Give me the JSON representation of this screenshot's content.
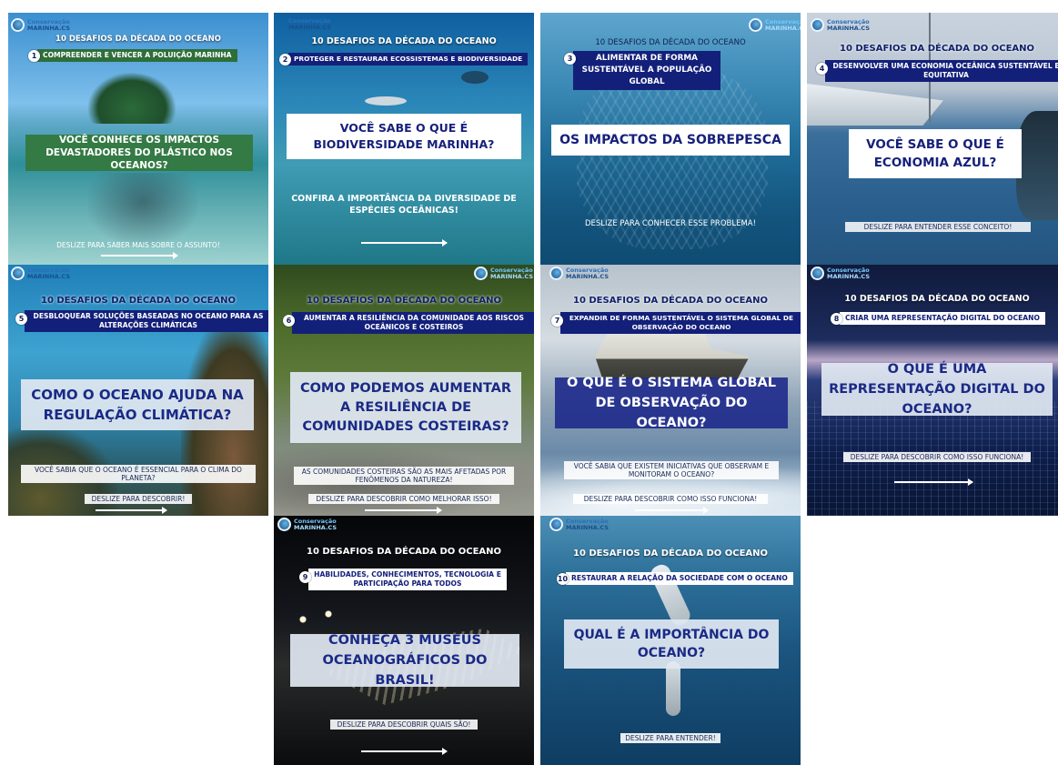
{
  "brand": {
    "line1": "Conservação",
    "line2": "MARINHA.CS"
  },
  "series_title": "10 DESAFIOS DA DÉCADA DO OCEANO",
  "cards": [
    {
      "num": "1",
      "challenge": "COMPREENDER E VENCER A POLUIÇÃO MARINHA",
      "question": "VOCÊ CONHECE OS IMPACTOS DEVASTADORES DO PLÁSTICO NOS OCEANOS?",
      "cta": "DESLIZE PARA SABER MAIS SOBRE O ASSUNTO!"
    },
    {
      "num": "2",
      "challenge": "PROTEGER E RESTAURAR ECOSSISTEMAS E BIODIVERSIDADE",
      "question": "VOCÊ SABE O QUE É BIODIVERSIDADE MARINHA?",
      "subtext": "CONFIRA A IMPORTÂNCIA DA DIVERSIDADE DE ESPÉCIES OCEÂNICAS!"
    },
    {
      "num": "3",
      "challenge": "ALIMENTAR DE FORMA SUSTENTÁVEL A POPULAÇÃO GLOBAL",
      "question": "OS IMPACTOS DA SOBREPESCA",
      "cta": "DESLIZE PARA CONHECER ESSE PROBLEMA!"
    },
    {
      "num": "4",
      "challenge": "DESENVOLVER UMA ECONOMIA OCEÂNICA SUSTENTÁVEL E EQUITATIVA",
      "question": "VOCÊ SABE O QUE É ECONOMIA AZUL?",
      "cta": "DESLIZE PARA ENTENDER ESSE CONCEITO!"
    },
    {
      "num": "5",
      "challenge": "DESBLOQUEAR SOLUÇÕES BASEADAS NO OCEANO PARA AS ALTERAÇÕES CLIMÁTICAS",
      "question": "COMO O OCEANO AJUDA NA REGULAÇÃO CLIMÁTICA?",
      "info": "VOCÊ SABIA QUE O OCEANO É ESSENCIAL PARA O CLIMA DO PLANETA?",
      "cta": "DESLIZE PARA DESCOBRIR!"
    },
    {
      "num": "6",
      "challenge": "AUMENTAR A RESILIÊNCIA DA COMUNIDADE AOS RISCOS OCEÂNICOS E COSTEIROS",
      "question": "COMO PODEMOS AUMENTAR A RESILIÊNCIA DE COMUNIDADES COSTEIRAS?",
      "info": "AS COMUNIDADES COSTEIRAS SÃO AS MAIS AFETADAS POR FENÔMENOS DA NATUREZA!",
      "cta": "DESLIZE PARA DESCOBRIR COMO MELHORAR ISSO!"
    },
    {
      "num": "7",
      "challenge": "EXPANDIR DE FORMA SUSTENTÁVEL O SISTEMA GLOBAL DE OBSERVAÇÃO DO OCEANO",
      "question": "O QUE É O SISTEMA GLOBAL DE OBSERVAÇÃO DO OCEANO?",
      "info": "VOCÊ SABIA QUE EXISTEM INICIATIVAS QUE OBSERVAM E MONITORAM O OCEANO?",
      "cta": "DESLIZE PARA DESCOBRIR COMO ISSO FUNCIONA!"
    },
    {
      "num": "8",
      "challenge": "CRIAR UMA REPRESENTAÇÃO DIGITAL DO OCEANO",
      "question": "O QUE É UMA REPRESENTAÇÃO DIGITAL DO OCEANO?",
      "cta": "DESLIZE PARA DESCOBRIR COMO ISSO FUNCIONA!"
    },
    {
      "num": "9",
      "challenge": "HABILIDADES, CONHECIMENTOS, TECNOLOGIA E PARTICIPAÇÃO PARA TODOS",
      "question": "CONHEÇA 3 MUSEUS OCEANOGRÁFICOS DO BRASIL!",
      "cta": "DESLIZE PARA DESCOBRIR QUAIS SÃO!"
    },
    {
      "num": "10",
      "challenge": "RESTAURAR A RELAÇÃO DA SOCIEDADE COM O OCEANO",
      "question": "QUAL É A IMPORTÂNCIA DO OCEANO?",
      "cta": "DESLIZE PARA ENTENDER!"
    }
  ]
}
